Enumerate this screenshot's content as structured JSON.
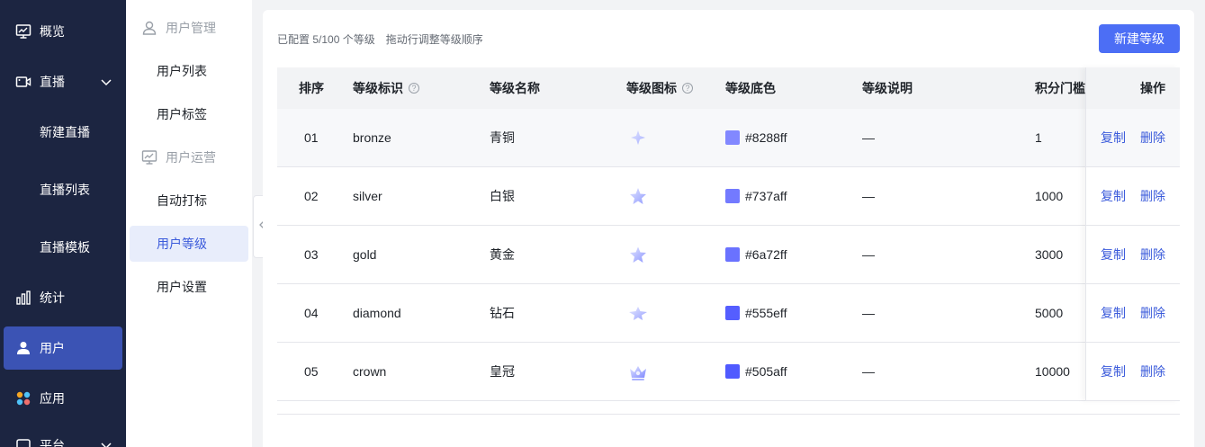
{
  "nav_primary": {
    "items": [
      {
        "label": "概览",
        "icon": "monitor-chart-icon"
      },
      {
        "label": "直播",
        "icon": "camera-icon",
        "expandable": true
      },
      {
        "label": "新建直播"
      },
      {
        "label": "直播列表"
      },
      {
        "label": "直播模板"
      },
      {
        "label": "统计",
        "icon": "bar-chart-icon"
      },
      {
        "label": "用户",
        "icon": "user-icon",
        "active": true
      },
      {
        "label": "应用",
        "icon": "apps-icon"
      },
      {
        "label": "平台",
        "icon": "platform-icon"
      }
    ]
  },
  "nav_secondary": {
    "groups": [
      {
        "label": "用户管理",
        "icon": "user-outline-icon"
      },
      {
        "label": "用户运营",
        "icon": "monitor-outline-icon"
      }
    ],
    "items": [
      {
        "label": "用户列表"
      },
      {
        "label": "用户标签"
      },
      {
        "label": "自动打标"
      },
      {
        "label": "用户等级",
        "active": true
      },
      {
        "label": "用户设置"
      }
    ]
  },
  "toolbar": {
    "count_text": "已配置 5/100 个等级",
    "hint_text": "拖动行调整等级顺序",
    "new_button": "新建等级"
  },
  "table": {
    "headers": {
      "order": "排序",
      "key": "等级标识",
      "name": "等级名称",
      "icon": "等级图标",
      "color": "等级底色",
      "desc": "等级说明",
      "points": "积分门槛",
      "actions": "操作"
    },
    "rows": [
      {
        "order": "01",
        "key": "bronze",
        "name": "青铜",
        "icon": "star-small-icon",
        "color": "#8288ff",
        "desc": "—",
        "points": "1"
      },
      {
        "order": "02",
        "key": "silver",
        "name": "白银",
        "icon": "star-icon",
        "color": "#737aff",
        "desc": "—",
        "points": "1000"
      },
      {
        "order": "03",
        "key": "gold",
        "name": "黄金",
        "icon": "star-icon",
        "color": "#6a72ff",
        "desc": "—",
        "points": "3000"
      },
      {
        "order": "04",
        "key": "diamond",
        "name": "钻石",
        "icon": "star-wide-icon",
        "color": "#555eff",
        "desc": "—",
        "points": "5000"
      },
      {
        "order": "05",
        "key": "crown",
        "name": "皇冠",
        "icon": "crown-icon",
        "color": "#505aff",
        "desc": "—",
        "points": "10000"
      }
    ],
    "copy_label": "复制",
    "delete_label": "删除"
  }
}
